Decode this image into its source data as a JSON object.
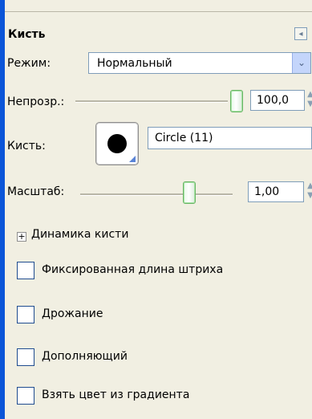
{
  "panel": {
    "title": "Кисть",
    "collapse_icon": "collapse-left-icon"
  },
  "mode": {
    "label": "Режим:",
    "value": "Нормальный",
    "dropdown_icon": "chevron-down-icon"
  },
  "opacity": {
    "label": "Непрозр.:",
    "value": "100,0",
    "slider_fraction": 1.0
  },
  "brush": {
    "label": "Кисть:",
    "preview_icon": "brush-circle-icon",
    "name": "Circle (11)"
  },
  "scale": {
    "label": "Масштаб:",
    "value": "1,00",
    "slider_fraction": 0.72
  },
  "dynamics": {
    "label": "Динамика кисти",
    "expander_icon": "plus-expander-icon"
  },
  "options": [
    {
      "label": "Фиксированная длина штриха",
      "checked": false
    },
    {
      "label": "Дрожание",
      "checked": false
    },
    {
      "label": "Дополняющий",
      "checked": false
    },
    {
      "label": "Взять цвет из градиента",
      "checked": false
    }
  ],
  "colors": {
    "window_border": "#0b55d8",
    "panel_bg": "#f1efe2",
    "field_border": "#7f9db9",
    "slider_thumb": "#68b565",
    "dropdown_accent": "#c4d5fb"
  }
}
